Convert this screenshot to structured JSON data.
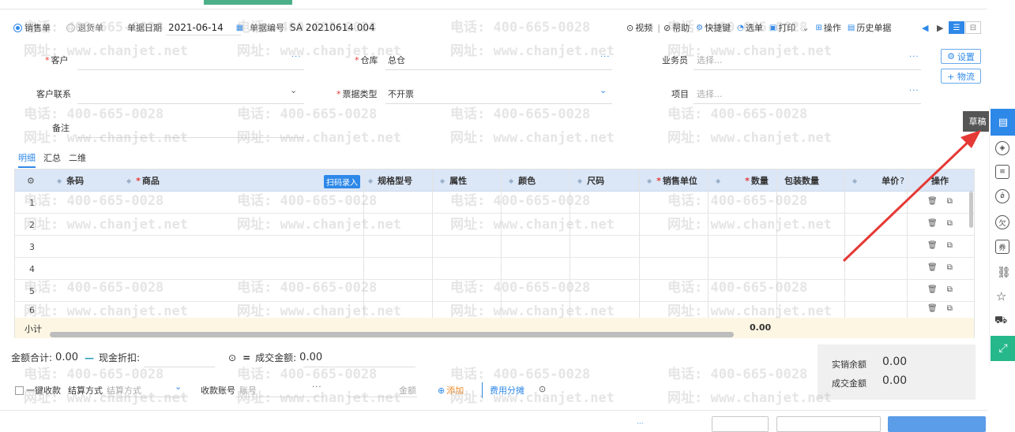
{
  "header": {
    "radio_sales": "销售单",
    "radio_return": "退货单",
    "date_label": "单据日期",
    "date_value": "2021-06-14",
    "docno_label": "单据编号",
    "docno_value": "SA 20210614 004",
    "tools": [
      "视频",
      "帮助",
      "快捷键",
      "选单",
      "打印",
      "操作",
      "历史单据"
    ]
  },
  "form": {
    "customer_label": "客户",
    "warehouse_label": "仓库",
    "warehouse_value": "总仓",
    "salesman_label": "业务员",
    "salesman_placeholder": "选择...",
    "customer_contact_label": "客户联系",
    "invoice_label": "票据类型",
    "invoice_value": "不开票",
    "project_label": "项目",
    "project_placeholder": "选择...",
    "remark_label": "备注",
    "settings_btn": "设置",
    "logistics_btn": "+ 物流"
  },
  "tabs": [
    "明细",
    "汇总",
    "二维"
  ],
  "grid": {
    "columns": [
      "条码",
      "商品",
      "规格型号",
      "属性",
      "颜色",
      "尺码",
      "销售单位",
      "数量",
      "包装数量",
      "单价",
      "操作"
    ],
    "scan_chip": "扫码录入",
    "rows": [
      "1",
      "2",
      "3",
      "4",
      "5",
      "6"
    ],
    "subtotal_label": "小计",
    "subtotal_qty": "0.00"
  },
  "footer": {
    "total_label": "金额合计:",
    "total_value": "0.00",
    "discount_label": "现金折扣:",
    "deal_label": "成交金额:",
    "deal_value": "0.00",
    "oneclick_label": "一键收款",
    "settle_label": "结算方式",
    "settle_placeholder": "结算方式",
    "account_label": "收款账号",
    "account_placeholder": "账号",
    "amount_placeholder": "金额",
    "add_label": "添加",
    "fee_label": "费用分摊",
    "actual_label": "实销余额",
    "actual_value": "0.00",
    "deal2_label": "成交金额",
    "deal2_value": "0.00"
  },
  "side_panel": {
    "draft_label": "草稿"
  },
  "watermark": {
    "phone": "电话: 400-665-0028",
    "site": "网址: www.chanjet.net"
  },
  "colors": {
    "accent": "#2e88e8",
    "header_row": "#dbe7f7",
    "subtotal_row": "#fdf6e3",
    "arrow": "#e53935"
  }
}
